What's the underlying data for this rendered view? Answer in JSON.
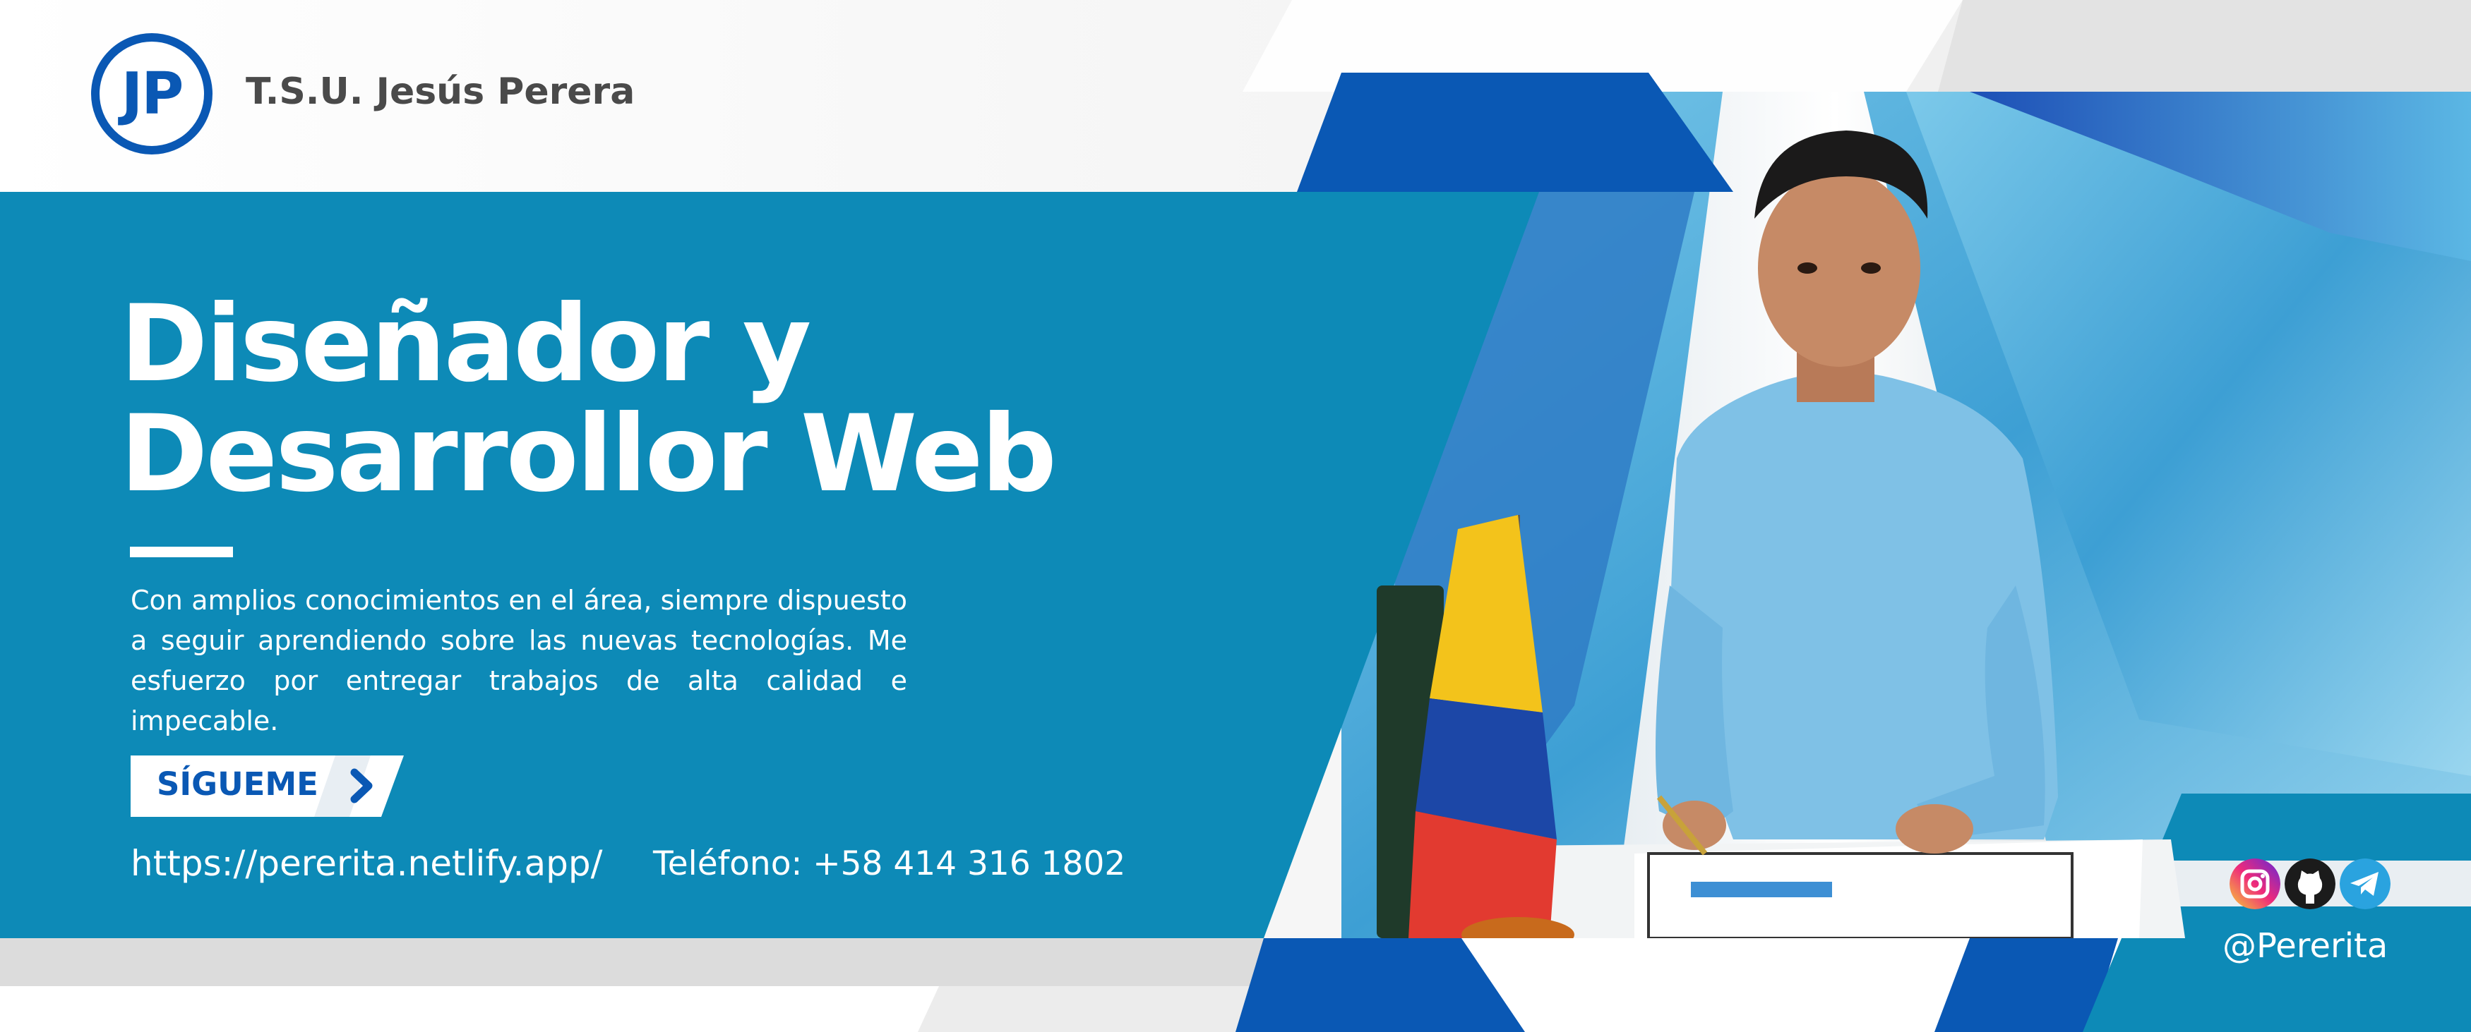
{
  "brand": {
    "logo_text": "JP",
    "name": "T.S.U. Jesús Perera"
  },
  "hero": {
    "headline_line1": "Diseñador y",
    "headline_line2": "Desarrollor Web",
    "description": "Con amplios conocimientos en el área, siempre dispuesto a seguir aprendiendo sobre las nuevas tecnologías. Me esfuerzo por entregar trabajos de alta calidad e impecable."
  },
  "actions": {
    "follow_label": "SÍGUEME"
  },
  "contact": {
    "url": "https://pererita.netlify.app/",
    "phone": "Teléfono: +58 414 316 1802"
  },
  "social": {
    "icons": [
      "instagram-icon",
      "github-icon",
      "telegram-icon"
    ],
    "handle": "@Pererita"
  },
  "colors": {
    "primary_teal": "#0d8ab7",
    "brand_blue": "#0a58b4",
    "light_gray": "#f6f6f6",
    "text_gray": "#4a4a4a"
  }
}
